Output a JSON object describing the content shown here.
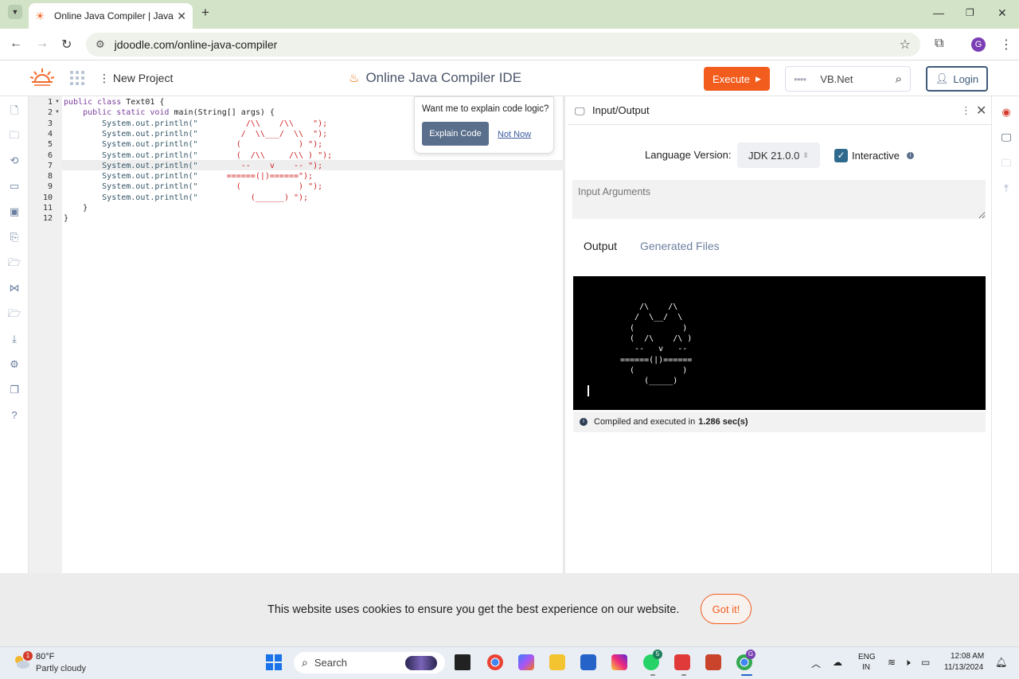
{
  "browser": {
    "tab_title": "Online Java Compiler | Java Edit",
    "url": "jdoodle.com/online-java-compiler",
    "profile_initial": "G"
  },
  "header": {
    "new_project": "New Project",
    "title": "Online Java Compiler IDE",
    "execute": "Execute",
    "language": "VB.Net",
    "login": "Login"
  },
  "editor": {
    "line_numbers": [
      "1",
      "2",
      "3",
      "4",
      "5",
      "6",
      "7",
      "8",
      "9",
      "10",
      "11",
      "12"
    ],
    "lines": [
      [
        "public class ",
        "Text01 {"
      ],
      [
        "    public static void ",
        "main(String[] args) {"
      ],
      [
        "        System.out.println(\"",
        "          /\\\\    /\\\\    ",
        "\");"
      ],
      [
        "        System.out.println(\"",
        "         /  \\\\___/  \\\\  ",
        "\");"
      ],
      [
        "        System.out.println(\"",
        "        (            ) ",
        "\");"
      ],
      [
        "        System.out.println(\"",
        "        (  /\\\\     /\\\\ ) ",
        "\");"
      ],
      [
        "        System.out.println(\"",
        "         --    v    -- ",
        "\");"
      ],
      [
        "        System.out.println(\"",
        "      ======(|)======",
        "\");"
      ],
      [
        "        System.out.println(\"",
        "        (            ) ",
        "\");"
      ],
      [
        "        System.out.println(\"",
        "           (______) ",
        "\");"
      ],
      [
        "    }"
      ],
      [
        "}"
      ]
    ],
    "explain_prompt": "Want me to explain code logic?",
    "explain_button": "Explain Code",
    "not_now": "Not Now"
  },
  "io": {
    "title": "Input/Output",
    "language_version_label": "Language Version:",
    "language_version": "JDK 21.0.0",
    "interactive_label": "Interactive",
    "interactive_checked": true,
    "args_placeholder": "Input Arguments",
    "tab_output": "Output",
    "tab_generated": "Generated Files",
    "output_lines": [
      "    /\\    /\\",
      "   /  \\__/  \\",
      "  (          )",
      "  (  /\\    /\\ )",
      "   --   v   --",
      "======(|)======",
      "  (          )",
      "     (_____)"
    ],
    "status_prefix": "Compiled and executed in",
    "status_time": "1.286 sec(s)"
  },
  "cookie": {
    "text": "This website uses cookies to ensure you get the best experience on our website.",
    "button": "Got it!"
  },
  "taskbar": {
    "weather_badge": "1",
    "temperature": "80°F",
    "condition": "Partly cloudy",
    "search_label": "Search",
    "whatsapp_badge": "5",
    "chrome_badge": "G",
    "lang_line1": "ENG",
    "lang_line2": "IN",
    "time": "12:08 AM",
    "date": "11/13/2024"
  },
  "colors": {
    "accent": "#f25c1c",
    "tabbar_bg": "#d3e3c8",
    "console_bg": "#000000",
    "login_border": "#3f5a7a"
  }
}
